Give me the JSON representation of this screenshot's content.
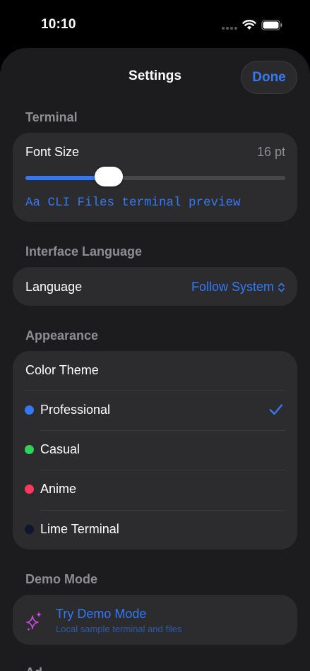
{
  "status_bar": {
    "time": "10:10"
  },
  "nav": {
    "title": "Settings",
    "done_label": "Done"
  },
  "terminal": {
    "header": "Terminal",
    "font_size_label": "Font Size",
    "font_size_value": "16 pt",
    "font_size_fraction": 0.32,
    "preview": "Aa CLI Files terminal preview"
  },
  "interface_language": {
    "header": "Interface Language",
    "language_label": "Language",
    "language_value": "Follow System"
  },
  "appearance": {
    "header": "Appearance",
    "color_theme_label": "Color Theme",
    "themes": [
      {
        "label": "Professional",
        "color": "#3478f6",
        "selected": true
      },
      {
        "label": "Casual",
        "color": "#30d158",
        "selected": false
      },
      {
        "label": "Anime",
        "color": "#ff375f",
        "selected": false
      },
      {
        "label": "Lime Terminal",
        "color": "#0f1630",
        "selected": false
      }
    ]
  },
  "demo_mode": {
    "header": "Demo Mode",
    "title": "Try Demo Mode",
    "subtitle": "Local sample terminal and files",
    "icon": "sparkles-icon"
  },
  "next_section": {
    "header_partial": "Ad"
  },
  "colors": {
    "accent": "#3478f6",
    "background": "#1c1c1e",
    "card": "#2c2c2e",
    "secondary_text": "#8e8e93"
  }
}
